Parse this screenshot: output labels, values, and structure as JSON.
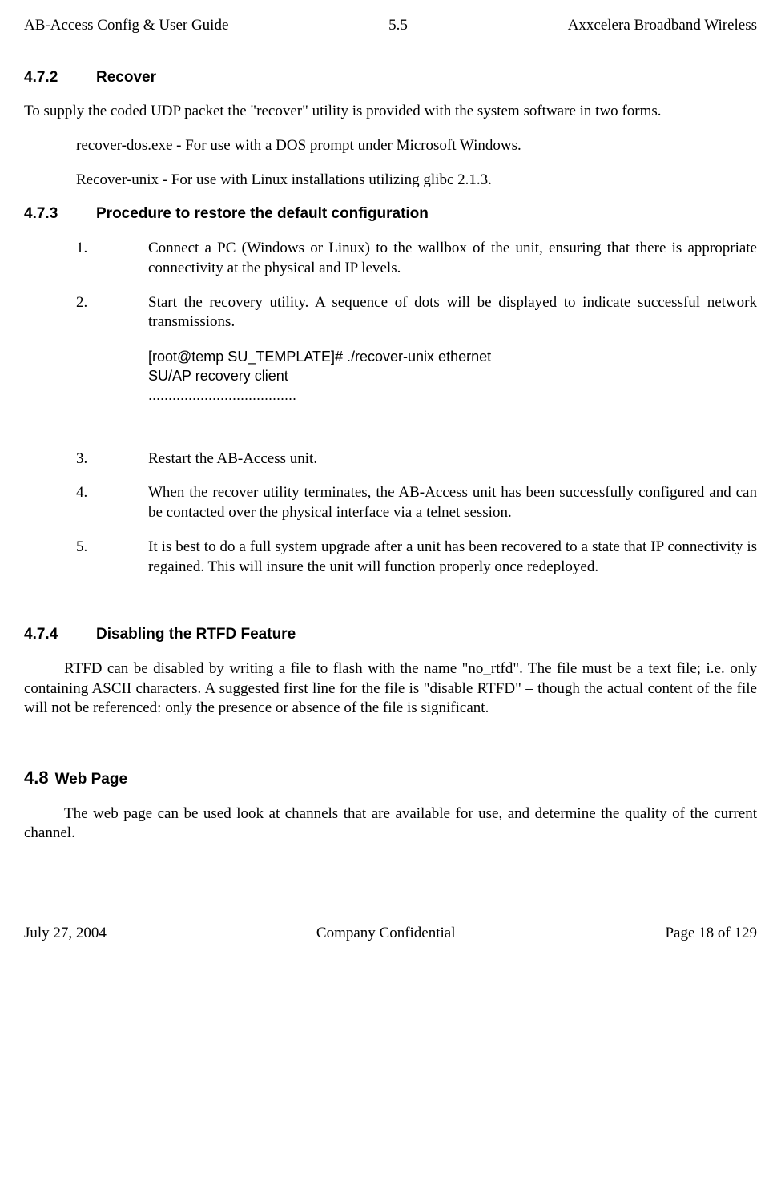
{
  "header": {
    "left": "AB-Access Config & User Guide",
    "center": "5.5",
    "right": "Axxcelera Broadband Wireless"
  },
  "section_472": {
    "number": "4.7.2",
    "title": "Recover",
    "para": "To supply the coded UDP packet the \"recover\" utility is provided with the system software in two forms.",
    "item1": "recover-dos.exe  -  For use with a DOS prompt under Microsoft Windows.",
    "item2": "Recover-unix  -  For use with Linux installations utilizing glibc 2.1.3."
  },
  "section_473": {
    "number": "4.7.3",
    "title": "Procedure to restore the default configuration",
    "steps": [
      {
        "n": "1.",
        "t": "Connect a PC (Windows or Linux) to the wallbox of the unit, ensuring that there is appropriate connectivity at the physical and IP levels."
      },
      {
        "n": "2.",
        "t": "Start the recovery utility. A sequence of dots will be displayed to indicate successful network transmissions."
      },
      {
        "n": "3.",
        "t": "Restart the AB-Access unit."
      },
      {
        "n": "4.",
        "t": "When the recover utility terminates, the AB-Access unit has been successfully configured and can be contacted over the physical interface via a telnet session."
      },
      {
        "n": "5.",
        "t": "It is best to do a full system upgrade after a unit has been recovered to a state that IP connectivity is regained. This will insure the unit will function properly once redeployed."
      }
    ],
    "code": {
      "l1": "[root@temp SU_TEMPLATE]# ./recover-unix ethernet",
      "l2": "SU/AP recovery client",
      "l3": " ....................................."
    }
  },
  "section_474": {
    "number": "4.7.4",
    "title": "Disabling the RTFD Feature",
    "para": "RTFD can be disabled by writing a file to flash with the name \"no_rtfd\". The file must be a text file; i.e. only containing ASCII characters. A suggested first line for the file is \"disable RTFD\" – though the actual content of the file will not be referenced: only the presence or absence of the file is significant."
  },
  "section_48": {
    "number": "4.8",
    "title": "Web Page",
    "para": "The web page can be used look at channels that are available for use, and determine the quality of the current channel."
  },
  "footer": {
    "left": "July 27, 2004",
    "center": "Company Confidential",
    "right": "Page 18 of 129"
  }
}
